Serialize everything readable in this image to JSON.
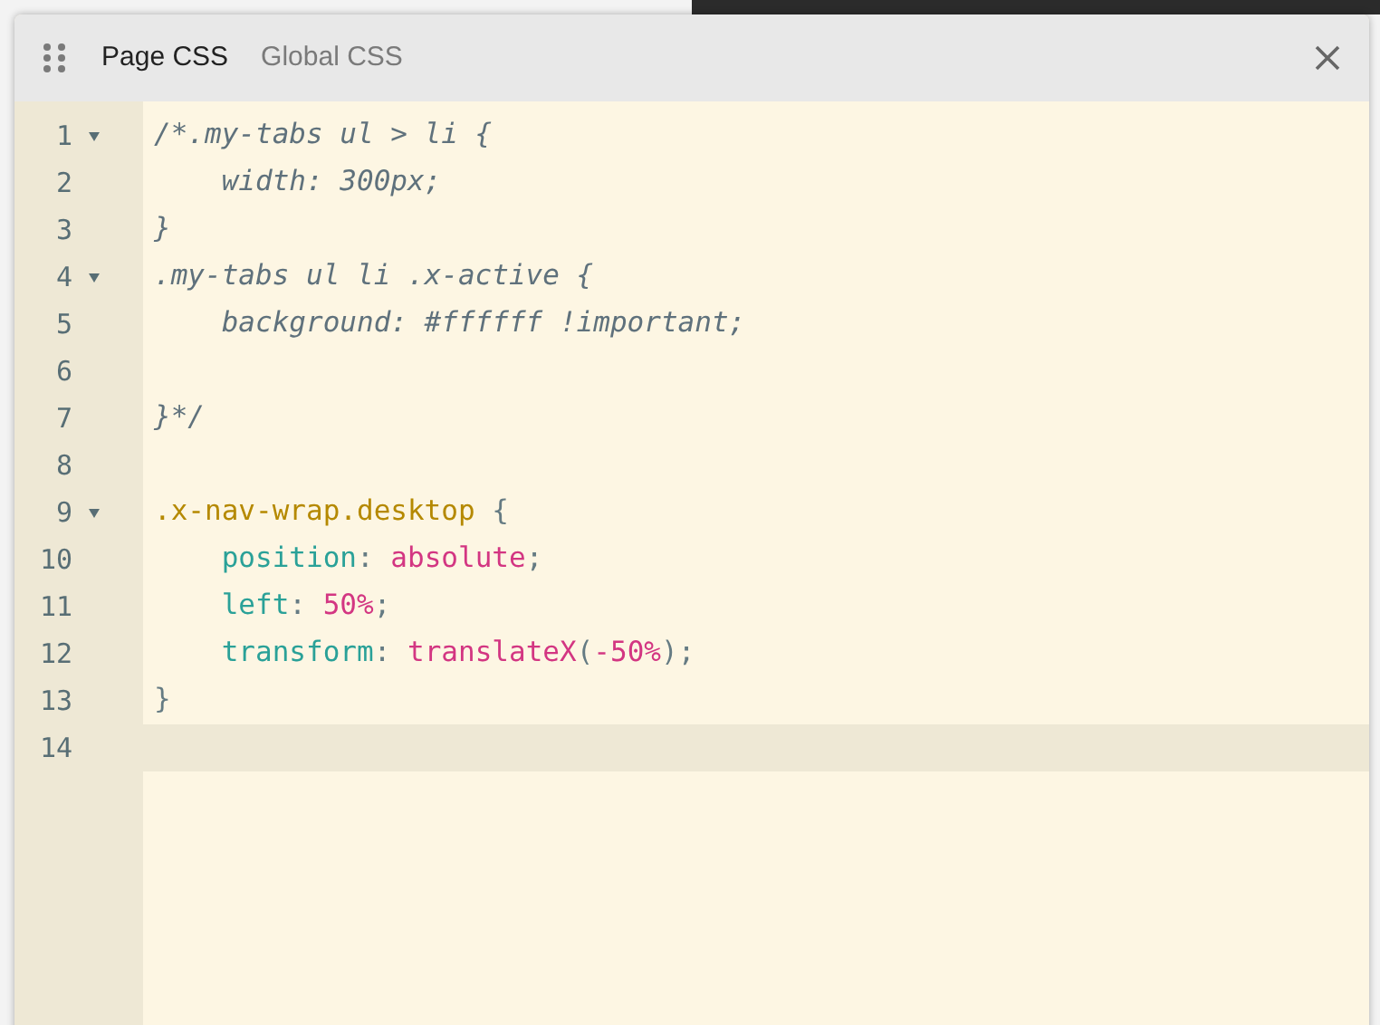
{
  "tabs": [
    {
      "label": "Page CSS",
      "selected": true
    },
    {
      "label": "Global CSS",
      "selected": false
    }
  ],
  "lines": [
    {
      "number": "1",
      "foldable": true,
      "active": false,
      "tokens": [
        {
          "kind": "comment",
          "text": "/*.my-tabs ul > li {"
        }
      ]
    },
    {
      "number": "2",
      "foldable": false,
      "active": false,
      "tokens": [
        {
          "kind": "comment",
          "text": "    width: 300px;"
        }
      ]
    },
    {
      "number": "3",
      "foldable": false,
      "active": false,
      "tokens": [
        {
          "kind": "comment",
          "text": "}"
        }
      ]
    },
    {
      "number": "4",
      "foldable": true,
      "active": false,
      "tokens": [
        {
          "kind": "comment",
          "text": ".my-tabs ul li .x-active {"
        }
      ]
    },
    {
      "number": "5",
      "foldable": false,
      "active": false,
      "tokens": [
        {
          "kind": "comment",
          "text": "    background: #ffffff !important;"
        }
      ]
    },
    {
      "number": "6",
      "foldable": false,
      "active": false
    },
    {
      "number": "7",
      "foldable": false,
      "active": false,
      "tokens": [
        {
          "kind": "comment",
          "text": "}*/"
        }
      ]
    },
    {
      "number": "8",
      "foldable": false,
      "active": false
    },
    {
      "number": "9",
      "foldable": true,
      "active": false,
      "tokens": [
        {
          "kind": "selector",
          "text": ".x-nav-wrap.desktop"
        },
        {
          "kind": "punct",
          "text": " {"
        }
      ]
    },
    {
      "number": "10",
      "foldable": false,
      "active": false,
      "tokens": [
        {
          "kind": "property",
          "text": "    position"
        },
        {
          "kind": "punct",
          "text": ": "
        },
        {
          "kind": "value",
          "text": "absolute"
        },
        {
          "kind": "punct",
          "text": ";"
        }
      ]
    },
    {
      "number": "11",
      "foldable": false,
      "active": false,
      "tokens": [
        {
          "kind": "property",
          "text": "    left"
        },
        {
          "kind": "punct",
          "text": ": "
        },
        {
          "kind": "value",
          "text": "50%"
        },
        {
          "kind": "punct",
          "text": ";"
        }
      ]
    },
    {
      "number": "12",
      "foldable": false,
      "active": false,
      "tokens": [
        {
          "kind": "property",
          "text": "    transform"
        },
        {
          "kind": "punct",
          "text": ": "
        },
        {
          "kind": "value",
          "text": "translateX"
        },
        {
          "kind": "punct",
          "text": "("
        },
        {
          "kind": "value",
          "text": "-50%"
        },
        {
          "kind": "punct",
          "text": ");"
        }
      ]
    },
    {
      "number": "13",
      "foldable": false,
      "active": false,
      "tokens": [
        {
          "kind": "punct",
          "text": "}"
        }
      ]
    },
    {
      "number": "14",
      "foldable": false,
      "active": true
    }
  ]
}
